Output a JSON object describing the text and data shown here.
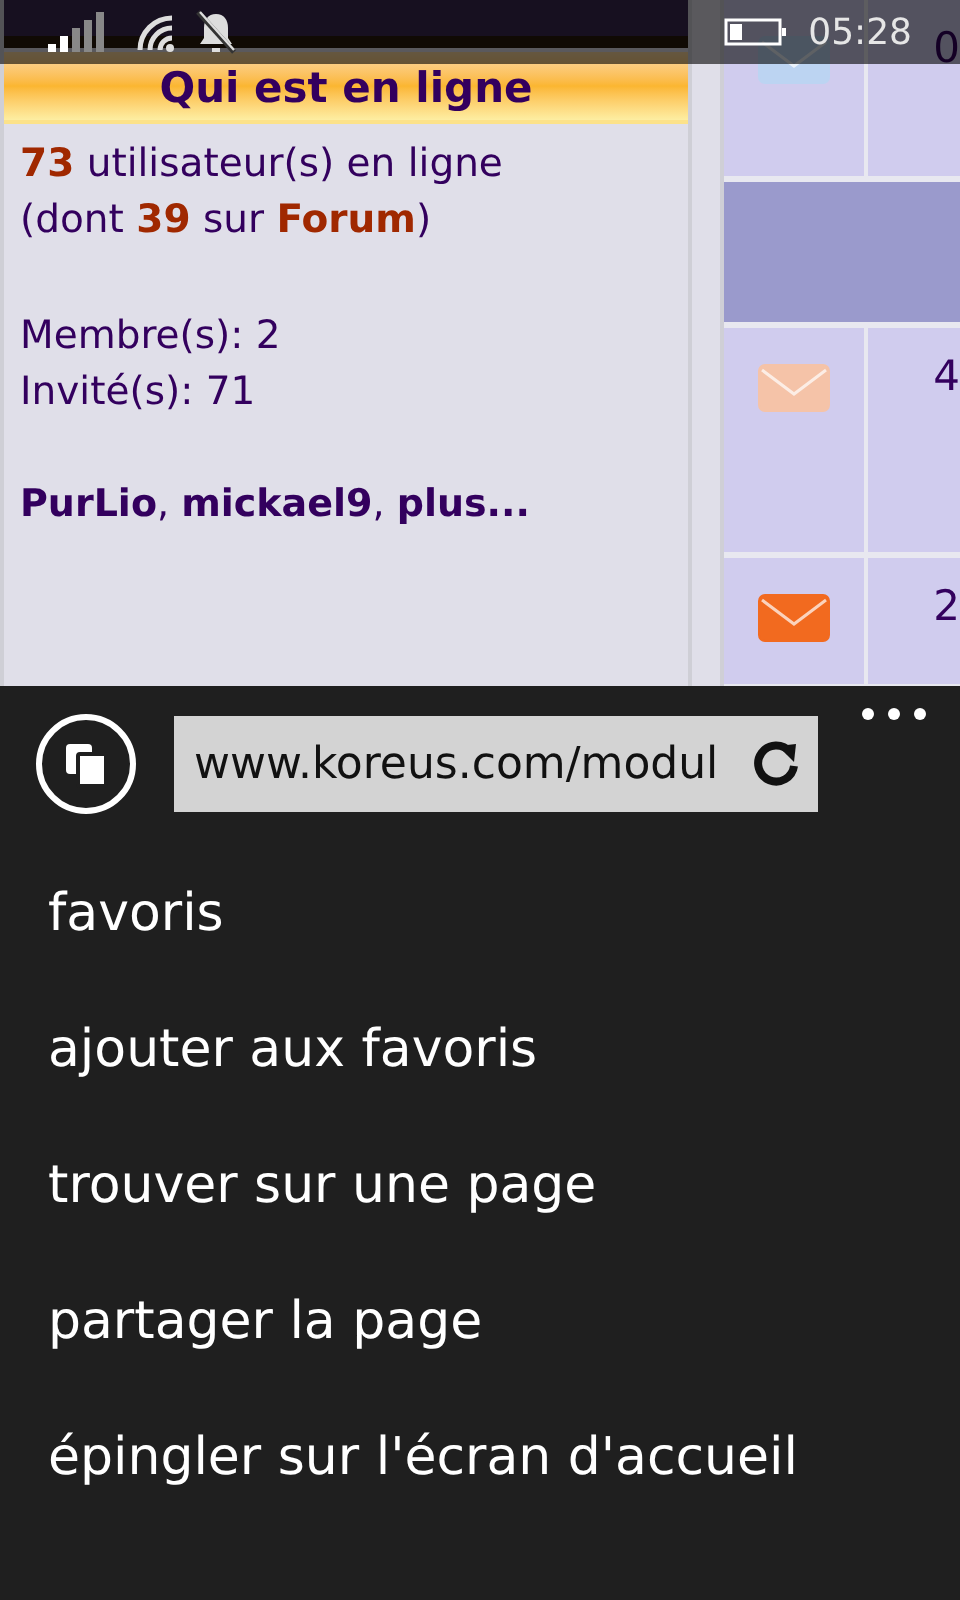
{
  "status_bar": {
    "time": "05:28"
  },
  "page": {
    "panel": {
      "title": "Qui est en ligne",
      "summary": "**73** utilisateur(s) en ligne (dont **39** sur **Forum**)",
      "members": "Membre(s): 2",
      "guests": "Invité(s): 71",
      "names": "**PurLio**, **mickael9**, **plus...**"
    },
    "table_rows": [
      {
        "kind": "read",
        "count": "0"
      },
      {
        "kind": "header"
      },
      {
        "kind": "faded",
        "count": "4"
      },
      {
        "kind": "new",
        "count": "2"
      }
    ]
  },
  "browser": {
    "url": "www.koreus.com/modul",
    "menu": [
      {
        "label": "favoris"
      },
      {
        "label": "ajouter aux favoris"
      },
      {
        "label": "trouver sur une page"
      },
      {
        "label": "partager la page"
      },
      {
        "label": "épingler sur l'écran d'accueil"
      }
    ]
  }
}
